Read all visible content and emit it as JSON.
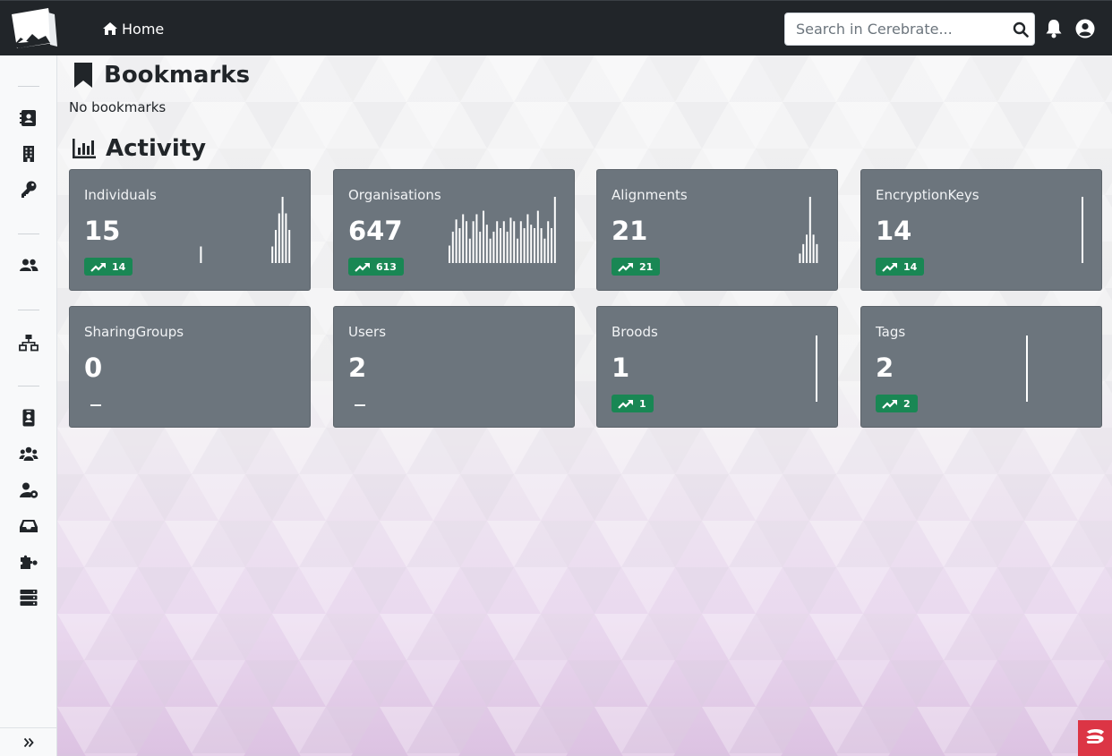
{
  "navbar": {
    "home_label": "Home",
    "search_placeholder": "Search in Cerebrate..."
  },
  "sidebar": {
    "items": [
      "address-card-icon",
      "building-icon",
      "key-icon",
      "users-icon",
      "network-icon",
      "id-badge-icon",
      "user-group-icon",
      "user-cog-icon",
      "inbox-icon",
      "puzzle-icon",
      "server-icon"
    ],
    "expand_icon": "double-chevron-right-icon"
  },
  "bookmarks": {
    "title": "Bookmarks",
    "empty_text": "No bookmarks"
  },
  "activity": {
    "title": "Activity",
    "cards": [
      {
        "title": "Individuals",
        "count": "15",
        "trend": "14",
        "spark": [
          0,
          0,
          0,
          0,
          0,
          0,
          0,
          0,
          0,
          0,
          0,
          0,
          0,
          0,
          0,
          0,
          0,
          0,
          0,
          0,
          0,
          0,
          0,
          1,
          0,
          0,
          0,
          0,
          0,
          0,
          0,
          0,
          0,
          0,
          0,
          0,
          0,
          0,
          0,
          0,
          0,
          0,
          0,
          0,
          1,
          2,
          3,
          4,
          3,
          2
        ]
      },
      {
        "title": "Organisations",
        "count": "647",
        "trend": "613",
        "spark": [
          10,
          18,
          25,
          20,
          28,
          24,
          14,
          24,
          28,
          18,
          30,
          22,
          14,
          18,
          24,
          20,
          24,
          18,
          26,
          24,
          14,
          24,
          20,
          28,
          22,
          20,
          30,
          20,
          14,
          24,
          20,
          38
        ]
      },
      {
        "title": "Alignments",
        "count": "21",
        "trend": "21",
        "spark": [
          0,
          0,
          0,
          0,
          0,
          0,
          0,
          0,
          0,
          0,
          0,
          0,
          0,
          0,
          0,
          0,
          0,
          0,
          0,
          0,
          0,
          0,
          0,
          0,
          0,
          0,
          0,
          0,
          0,
          0,
          0,
          0,
          0,
          0,
          0,
          0,
          0,
          0,
          0,
          0,
          0,
          0,
          0,
          0,
          0,
          0,
          0,
          0,
          1,
          2,
          3,
          7,
          3,
          2
        ]
      },
      {
        "title": "EncryptionKeys",
        "count": "14",
        "trend": "14",
        "spark": [
          0,
          0,
          0,
          0,
          0,
          0,
          0,
          0,
          0,
          0,
          0,
          0,
          0,
          0,
          0,
          0,
          0,
          0,
          0,
          0,
          0,
          0,
          0,
          0,
          0,
          0,
          0,
          0,
          0,
          0,
          0,
          0,
          0,
          0,
          0,
          0,
          0,
          0,
          0,
          0,
          0,
          0,
          0,
          0,
          0,
          0,
          0,
          0,
          0,
          0,
          0,
          0,
          0,
          0,
          0,
          0,
          0,
          0,
          0,
          0,
          14
        ]
      },
      {
        "title": "SharingGroups",
        "count": "0",
        "trend": "",
        "spark": []
      },
      {
        "title": "Users",
        "count": "2",
        "trend": "",
        "spark": []
      },
      {
        "title": "Broods",
        "count": "1",
        "trend": "1",
        "spark": [
          1
        ]
      },
      {
        "title": "Tags",
        "count": "2",
        "trend": "2",
        "spark": [
          1
        ]
      }
    ]
  },
  "colors": {
    "navbar": "#212529",
    "card": "#6c757d",
    "badge": "#198754",
    "corner_logo": "#dc3545"
  }
}
